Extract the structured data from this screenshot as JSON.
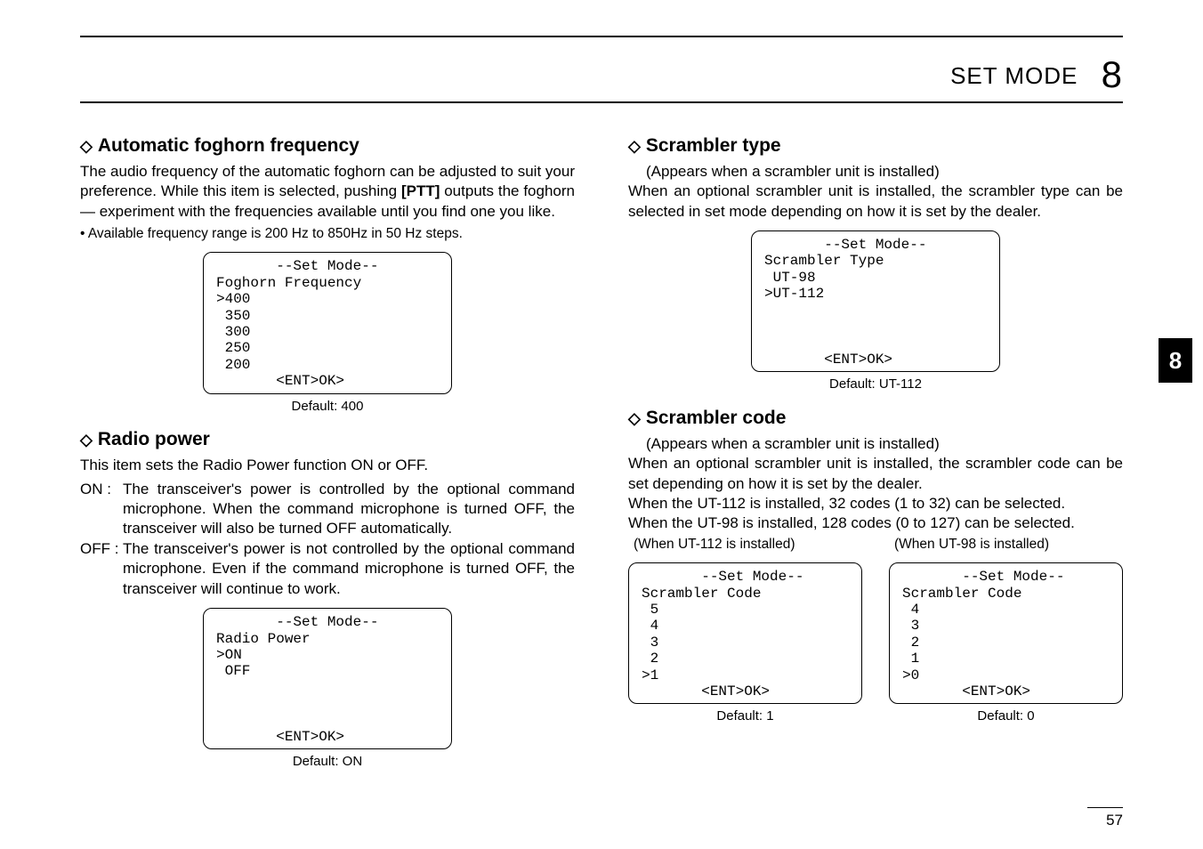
{
  "header": {
    "section": "SET MODE",
    "chapter": "8"
  },
  "sideTab": "8",
  "pageNumber": "57",
  "left": {
    "s1": {
      "title": "Automatic foghorn frequency",
      "p1": "The audio frequency of the automatic foghorn can be adjusted to suit your preference. While this item is selected, pushing ",
      "ptt": "[PTT]",
      "p1b": " outputs the foghorn— experiment with the frequencies available until you find one you like.",
      "bullet": "• Available frequency range is 200 Hz to 850Hz in 50 Hz steps.",
      "lcd": "       --Set Mode--\nFoghorn Frequency\n˃400\n 350\n 300\n 250\n 200\n       <ENT˃OK>",
      "caption": "Default: 400"
    },
    "s2": {
      "title": "Radio power",
      "intro": "This item sets the Radio Power function ON or OFF.",
      "onLabel": "ON  :",
      "onDesc": "The transceiver's power is controlled by the optional command microphone. When the command microphone is turned OFF, the transceiver will also be turned OFF automatically.",
      "offLabel": "OFF :",
      "offDesc": "The transceiver's power is not controlled by the optional command microphone. Even if the command microphone is turned OFF, the transceiver will continue to work.",
      "lcd": "       --Set Mode--\nRadio Power\n˃ON\n OFF\n\n\n\n       <ENT˃OK>",
      "caption": "Default: ON"
    }
  },
  "right": {
    "s1": {
      "title": "Scrambler type",
      "sub": "(Appears when a scrambler unit is installed)",
      "body": "When an optional scrambler unit is installed, the scrambler type can be selected in set mode depending on how it is set by the dealer.",
      "lcd": "       --Set Mode--\nScrambler Type\n UT-98\n˃UT-112\n\n\n\n       <ENT˃OK>",
      "caption": "Default: UT-112"
    },
    "s2": {
      "title": "Scrambler code",
      "sub": "(Appears when a scrambler unit is installed)",
      "p1": "When an optional scrambler unit is installed, the scrambler code can be set depending on how it is set by the dealer.",
      "p2": "When the UT-112 is installed, 32 codes (1 to 32) can be selected.",
      "p3": "When the UT-98 is installed, 128 codes (0 to 127) can be selected.",
      "whenA": "(When UT-112 is installed)",
      "whenB": "(When UT-98 is installed)",
      "lcdA": "       --Set Mode--\nScrambler Code\n 5\n 4\n 3\n 2\n˃1\n       <ENT˃OK>",
      "capA": "Default: 1",
      "lcdB": "       --Set Mode--\nScrambler Code\n 4\n 3\n 2\n 1\n˃0\n       <ENT˃OK>",
      "capB": "Default: 0"
    }
  }
}
